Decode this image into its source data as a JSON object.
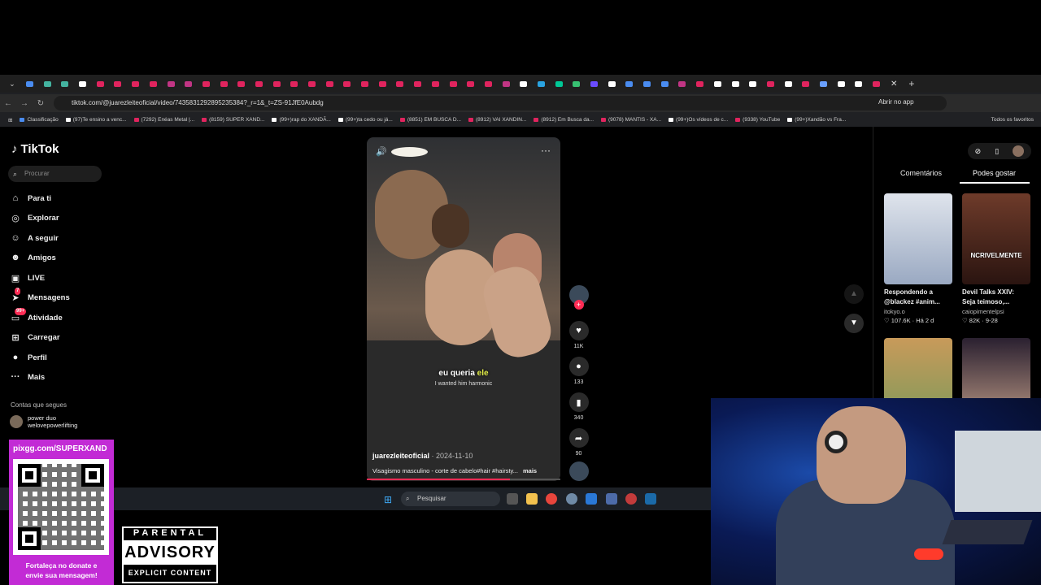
{
  "browser": {
    "url": "tiktok.com/@juarezleiteoficial/video/7435831292895235384?_r=1&_t=ZS-91JfE0Aubdg",
    "open_in_app": "Abrir no app",
    "tab_colors": [
      "#4a8cf0",
      "#44b3a0",
      "#44b3a0",
      "#ffffff",
      "#e0245e",
      "#e0245e",
      "#e0245e",
      "#e0245e",
      "#c13584",
      "#c13584",
      "#e0245e",
      "#e0245e",
      "#e0245e",
      "#e0245e",
      "#e0245e",
      "#e0245e",
      "#e0245e",
      "#e0245e",
      "#e0245e",
      "#e0245e",
      "#e0245e",
      "#e0245e",
      "#e0245e",
      "#e0245e",
      "#e0245e",
      "#e0245e",
      "#e0245e",
      "#c13584",
      "#ffffff",
      "#2aa3e0",
      "#00c896",
      "#38c172",
      "#6b4cff",
      "#ffffff",
      "#4a8cf0",
      "#4a8cf0",
      "#4a8cf0",
      "#c13584",
      "#e0245e",
      "#ffffff",
      "#ffffff",
      "#ffffff",
      "#e0245e",
      "#ffffff",
      "#e0245e",
      "#6aa0ff",
      "#ffffff",
      "#ffffff",
      "#e0245e"
    ],
    "bookmarks": [
      {
        "label": "Classificação",
        "color": "#4a8cf0"
      },
      {
        "label": "(97)Te ensino a venc...",
        "color": "#ffffff"
      },
      {
        "label": "(7292) Enéas Metal |...",
        "color": "#e0245e"
      },
      {
        "label": "(8159) SUPER XAND...",
        "color": "#e0245e"
      },
      {
        "label": "(99+)rap do XANDÃ...",
        "color": "#ffffff"
      },
      {
        "label": "(99+)ta cedo ou já...",
        "color": "#ffffff"
      },
      {
        "label": "(8851) EM BUSCA D...",
        "color": "#e0245e"
      },
      {
        "label": "(8912) VAI XANDIN...",
        "color": "#e0245e"
      },
      {
        "label": "(8912) Em Busca da...",
        "color": "#e0245e"
      },
      {
        "label": "(9078) MANTIS - XA...",
        "color": "#e0245e"
      },
      {
        "label": "(99+)Os vídeos de c...",
        "color": "#ffffff"
      },
      {
        "label": "(9338) YouTube",
        "color": "#e0245e"
      },
      {
        "label": "(99+)Xandão vs Fra...",
        "color": "#ffffff"
      }
    ],
    "all_bookmarks": "Todos os favoritos"
  },
  "tiktok": {
    "logo": "TikTok",
    "search_placeholder": "Procurar",
    "nav": [
      {
        "label": "Para ti",
        "icon": "home-icon",
        "glyph": "⌂"
      },
      {
        "label": "Explorar",
        "icon": "compass-icon",
        "glyph": "◎"
      },
      {
        "label": "A seguir",
        "icon": "following-icon",
        "glyph": "☺"
      },
      {
        "label": "Amigos",
        "icon": "friends-icon",
        "glyph": "☻"
      },
      {
        "label": "LIVE",
        "icon": "live-icon",
        "glyph": "▣"
      },
      {
        "label": "Mensagens",
        "icon": "messages-icon",
        "glyph": "➤",
        "badge": "7"
      },
      {
        "label": "Atividade",
        "icon": "activity-icon",
        "glyph": "▭",
        "badge": "99+"
      },
      {
        "label": "Carregar",
        "icon": "upload-icon",
        "glyph": "⊞"
      },
      {
        "label": "Perfil",
        "icon": "profile-avatar",
        "glyph": "●"
      },
      {
        "label": "Mais",
        "icon": "more-icon",
        "glyph": "···"
      }
    ],
    "following_title": "Contas que segues",
    "following": [
      {
        "name": "power duo",
        "handle": "welovepowerlifting"
      }
    ],
    "video": {
      "subtitle_pt_a": "eu queria",
      "subtitle_pt_b": "ele",
      "subtitle_en": "I wanted him harmonic",
      "username": "juarezleiteoficial",
      "date": " · 2024-11-10",
      "description": "Visagismo masculino - corte de cabelo#hair #hairsty...",
      "more": "mais",
      "progress": 0.74
    },
    "actions": {
      "likes": "11K",
      "comments": "133",
      "saves": "340",
      "shares": "90"
    },
    "right_tabs": {
      "comments": "Comentários",
      "suggested": "Podes gostar"
    },
    "suggestions": [
      {
        "title_1": "Respondendo a",
        "title_2": "@blackez #anim...",
        "author": "itokyo.o",
        "stats": "♡ 107.6K · Há 2 d",
        "overlay": "",
        "colors": [
          "#dfe4ec",
          "#9aa9c2"
        ]
      },
      {
        "title_1": "Devil Talks XXIV:",
        "title_2": "Seja teimoso,...",
        "author": "caiopimentelpsi",
        "stats": "♡ 82K · 9-28",
        "overlay": "NCRIVELMENTE",
        "colors": [
          "#6e3b2a",
          "#2a1410"
        ]
      },
      {
        "title_1": "",
        "title_2": "",
        "author": "",
        "stats": "",
        "overlay": "",
        "colors": [
          "#c89a5a",
          "#7a9a5a"
        ]
      },
      {
        "title_1": "",
        "title_2": "",
        "author": "",
        "stats": "",
        "overlay": "",
        "colors": [
          "#2a2030",
          "#c4a08a"
        ]
      }
    ]
  },
  "taskbar": {
    "search_placeholder": "Pesquisar"
  },
  "stream": {
    "qr_url": "pixgg.com/SUPERXAND",
    "qr_caption_1": "Fortaleça no donate e",
    "qr_caption_2": "envie sua mensagem!",
    "advisory_top": "PARENTAL",
    "advisory_mid": "ADVISORY",
    "advisory_bot": "EXPLICIT CONTENT"
  }
}
